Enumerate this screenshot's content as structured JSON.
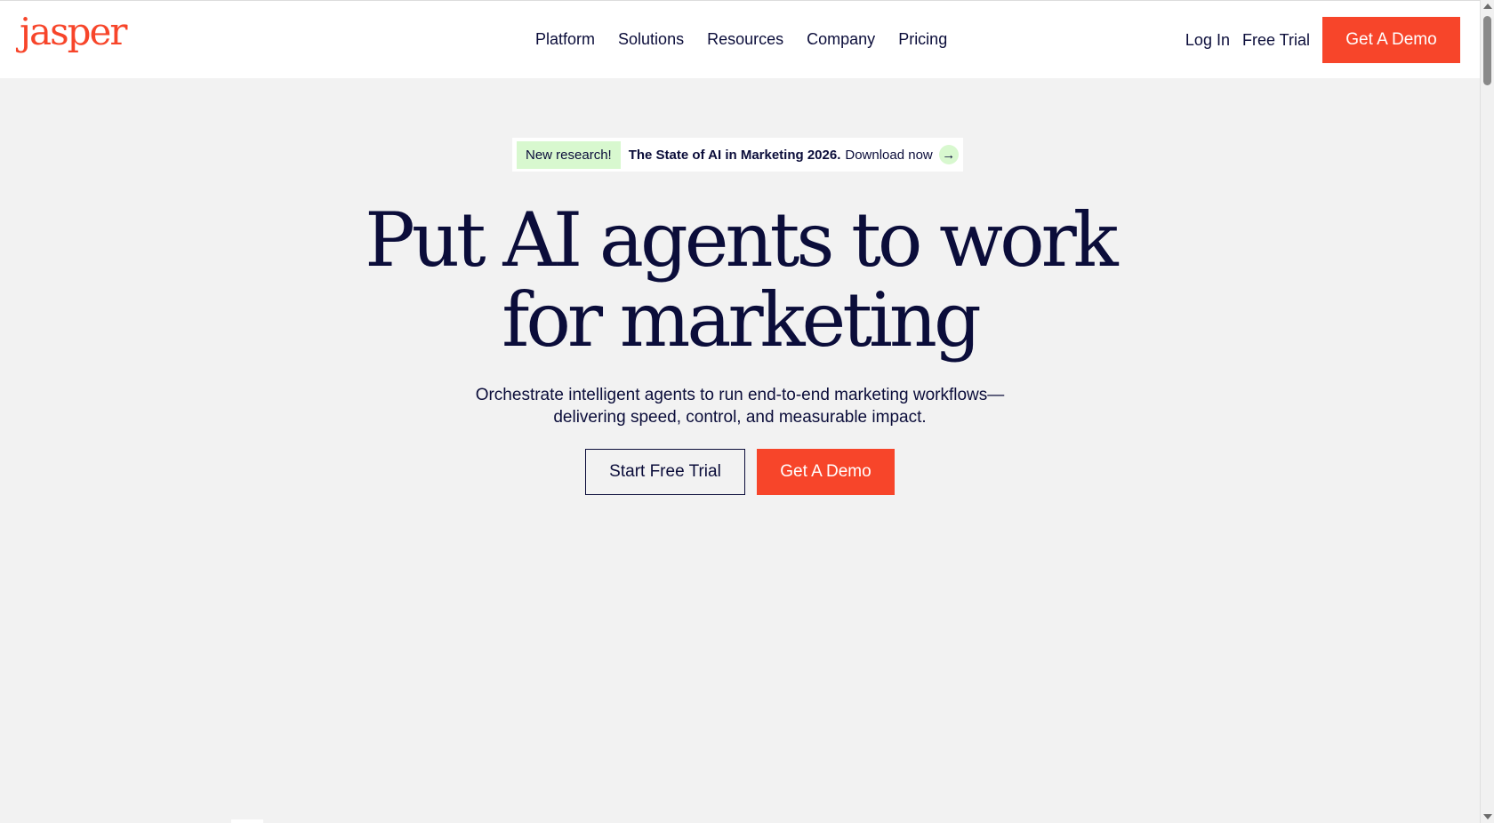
{
  "header": {
    "logo_text": "jasper",
    "nav": [
      {
        "label": "Platform"
      },
      {
        "label": "Solutions"
      },
      {
        "label": "Resources"
      },
      {
        "label": "Company"
      },
      {
        "label": "Pricing"
      }
    ],
    "login_label": "Log In",
    "free_trial_label": "Free Trial",
    "demo_label": "Get A Demo"
  },
  "announcement": {
    "badge": "New research!",
    "title": "The State of AI in Marketing 2026.",
    "cta": "Download now",
    "arrow": "→"
  },
  "hero": {
    "title_line1": "Put AI agents to work",
    "title_line2": "for marketing",
    "subtitle_line1": "Orchestrate intelligent agents to run end-to-end marketing workflows—",
    "subtitle_line2": "delivering speed, control, and measurable impact.",
    "trial_label": "Start Free Trial",
    "demo_label": "Get A Demo"
  },
  "colors": {
    "brand": "#f7452a",
    "text": "#0b0d3a",
    "background": "#f2f2f2",
    "badge": "#d8f8cf"
  }
}
